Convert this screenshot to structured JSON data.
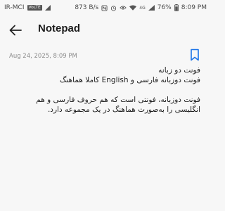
{
  "status_bar": {
    "carrier": "IR-MCI",
    "volte": "VoLTE",
    "network_type": "4G",
    "speed": "873 B/s",
    "battery": "76%",
    "time": "8:09 PM",
    "icons": [
      "nfc-icon",
      "alarm-icon",
      "eye-icon",
      "wifi-icon",
      "signal-icon",
      "battery-icon"
    ]
  },
  "app_bar": {
    "title": "Notepad",
    "back_icon": "back-arrow-icon"
  },
  "note": {
    "timestamp": "Aug 24, 2025, 8:09 PM",
    "bookmark_icon": "bookmark-icon",
    "lines": [
      "فونت دو زبانه",
      "فونت دوزبانه فارسی و English کاملا هماهنگ",
      "",
      "فونت دوزبانه، فونتی است که هم حروف فارسی و هم",
      "انگلیسی را به‌صورت هماهنگ در یک مجموعه دارد."
    ]
  },
  "colors": {
    "background": "#f7f7f7",
    "accent": "#1a73e8",
    "text": "#1a1a1a",
    "muted": "#8a8a8a"
  }
}
